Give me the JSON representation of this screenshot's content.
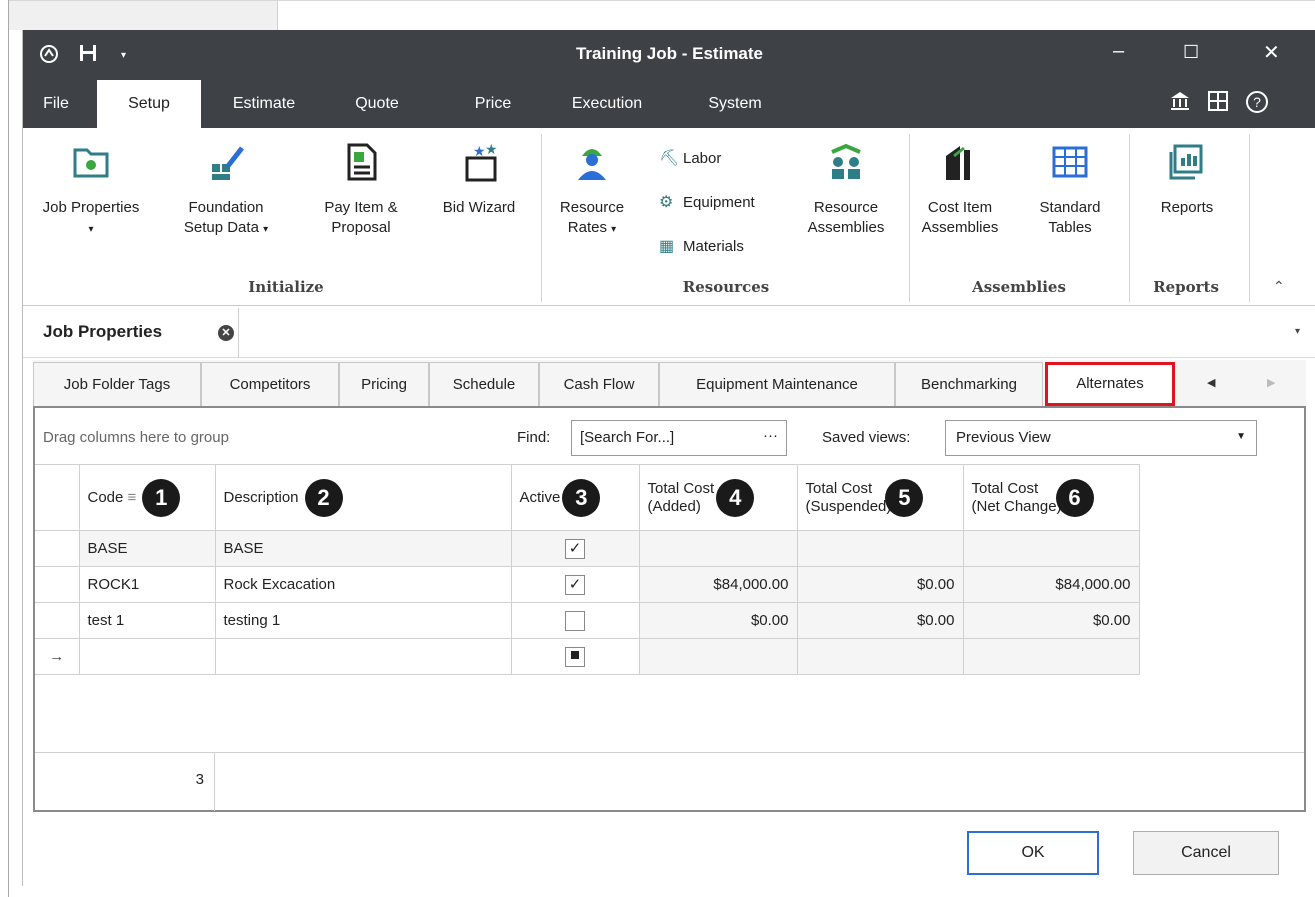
{
  "window": {
    "title": "Training Job - Estimate",
    "controls": {
      "minimize": "–",
      "maximize": "☐",
      "close": "✕"
    }
  },
  "ribbon_tabs": [
    "File",
    "Setup",
    "Estimate",
    "Quote",
    "Price",
    "Execution",
    "System"
  ],
  "ribbon_tab_active": "Setup",
  "ribbon": {
    "initialize": {
      "label": "Initialize",
      "job_properties": "Job Properties",
      "foundation_setup_data_1": "Foundation",
      "foundation_setup_data_2": "Setup Data",
      "pay_item_1": "Pay Item &",
      "pay_item_2": "Proposal",
      "bid_wizard": "Bid Wizard"
    },
    "resources": {
      "label": "Resources",
      "resource_rates_1": "Resource",
      "resource_rates_2": "Rates",
      "labor": "Labor",
      "equipment": "Equipment",
      "materials": "Materials",
      "resource_assemblies_1": "Resource",
      "resource_assemblies_2": "Assemblies"
    },
    "assemblies": {
      "label": "Assemblies",
      "cost_item_1": "Cost Item",
      "cost_item_2": "Assemblies",
      "standard_tables_1": "Standard",
      "standard_tables_2": "Tables"
    },
    "reports": {
      "label": "Reports",
      "reports_button": "Reports"
    }
  },
  "document_tab": {
    "title": "Job Properties"
  },
  "sub_tabs": [
    "Job Folder Tags",
    "Competitors",
    "Pricing",
    "Schedule",
    "Cash Flow",
    "Equipment Maintenance",
    "Benchmarking",
    "Alternates"
  ],
  "sub_tab_active": "Alternates",
  "toolbar": {
    "drag_hint": "Drag columns here to group",
    "find_label": "Find:",
    "find_placeholder": "[Search For...]",
    "find_button": "···",
    "saved_views_label": "Saved views:",
    "saved_views_value": "Previous View"
  },
  "grid": {
    "columns": {
      "code": "Code",
      "description": "Description",
      "active": "Active",
      "added_1": "Total Cost",
      "added_2": "(Added)",
      "suspended_1": "Total Cost",
      "suspended_2": "(Suspended)",
      "net_1": "Total Cost",
      "net_2": "(Net Change)"
    },
    "badges": [
      "1",
      "2",
      "3",
      "4",
      "5",
      "6"
    ],
    "rows": [
      {
        "code": "BASE",
        "description": "BASE",
        "active": true,
        "added": "",
        "suspended": "",
        "net": ""
      },
      {
        "code": "ROCK1",
        "description": "Rock Excacation",
        "active": true,
        "added": "$84,000.00",
        "suspended": "$0.00",
        "net": "$84,000.00"
      },
      {
        "code": "test 1",
        "description": "testing 1",
        "active": false,
        "added": "$0.00",
        "suspended": "$0.00",
        "net": "$0.00"
      }
    ],
    "new_row_indicator": "→",
    "check_mark": "✓",
    "footer_count": "3"
  },
  "buttons": {
    "ok": "OK",
    "cancel": "Cancel"
  },
  "colors": {
    "titlebar": "#3e4246",
    "highlight": "#e0141e",
    "ok_border": "#2f6fd4",
    "icon_teal": "#2f7d86"
  }
}
